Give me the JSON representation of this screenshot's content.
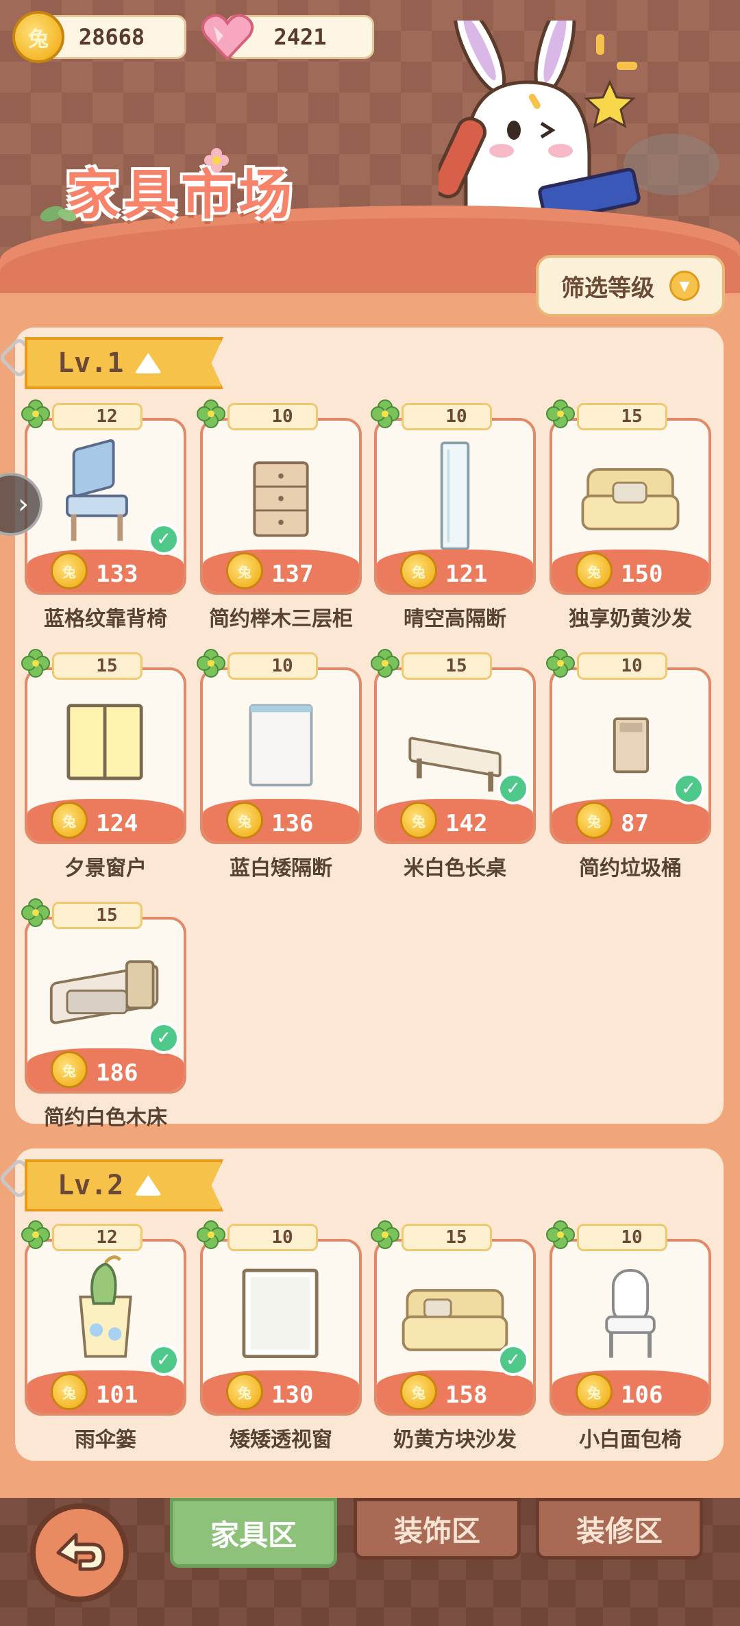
{
  "header": {
    "coins": "28668",
    "hearts": "2421",
    "title": "家具市场",
    "filter_label": "筛选等级"
  },
  "levels": [
    {
      "label": "Lv.1",
      "items": [
        {
          "level": "12",
          "price": "133",
          "name": "蓝格纹靠背椅",
          "owned": true,
          "art": "chair-blue"
        },
        {
          "level": "10",
          "price": "137",
          "name": "简约榉木三层柜",
          "owned": false,
          "art": "cabinet"
        },
        {
          "level": "10",
          "price": "121",
          "name": "晴空高隔断",
          "owned": false,
          "art": "tall-partition"
        },
        {
          "level": "15",
          "price": "150",
          "name": "独享奶黄沙发",
          "owned": false,
          "art": "armchair"
        },
        {
          "level": "15",
          "price": "124",
          "name": "夕景窗户",
          "owned": false,
          "art": "window-yellow"
        },
        {
          "level": "10",
          "price": "136",
          "name": "蓝白矮隔断",
          "owned": false,
          "art": "low-partition"
        },
        {
          "level": "15",
          "price": "142",
          "name": "米白色长桌",
          "owned": true,
          "art": "long-table"
        },
        {
          "level": "10",
          "price": "87",
          "name": "简约垃圾桶",
          "owned": true,
          "art": "trash-bin"
        },
        {
          "level": "15",
          "price": "186",
          "name": "简约白色木床",
          "owned": true,
          "art": "bed"
        }
      ]
    },
    {
      "label": "Lv.2",
      "items": [
        {
          "level": "12",
          "price": "101",
          "name": "雨伞篓",
          "owned": true,
          "art": "umbrella-stand"
        },
        {
          "level": "10",
          "price": "130",
          "name": "矮矮透视窗",
          "owned": false,
          "art": "window-white"
        },
        {
          "level": "15",
          "price": "158",
          "name": "奶黄方块沙发",
          "owned": true,
          "art": "sofa"
        },
        {
          "level": "10",
          "price": "106",
          "name": "小白面包椅",
          "owned": false,
          "art": "white-chair"
        }
      ]
    }
  ],
  "tabs": [
    {
      "label": "家具区",
      "active": true
    },
    {
      "label": "装饰区",
      "active": false
    },
    {
      "label": "装修区",
      "active": false
    }
  ],
  "colors": {
    "accent": "#ec7a5c",
    "panel": "#fbe7d4",
    "check": "#4ec98a",
    "level_tag": "#f7c24a"
  }
}
